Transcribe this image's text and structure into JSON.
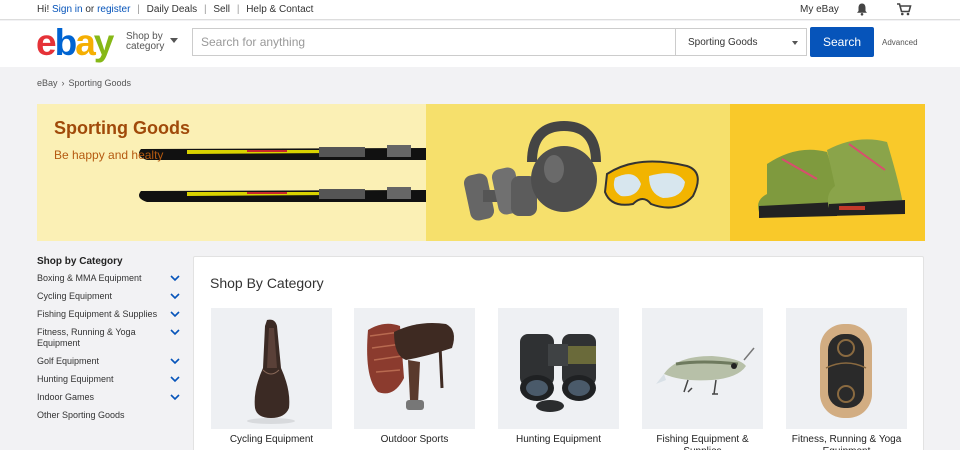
{
  "topbar": {
    "greeting": "Hi!",
    "sign_in": "Sign in",
    "or": "or",
    "register": "register",
    "links": [
      "Daily Deals",
      "Sell",
      "Help & Contact"
    ],
    "my_ebay": "My eBay"
  },
  "header": {
    "logo": {
      "e": "e",
      "b": "b",
      "a": "a",
      "y": "y"
    },
    "shop_by_line1": "Shop by",
    "shop_by_line2": "category",
    "search_placeholder": "Search for anything",
    "category_selected": "Sporting Goods",
    "search_button": "Search",
    "advanced": "Advanced"
  },
  "breadcrumb": {
    "home": "eBay",
    "chevron": "›",
    "current": "Sporting Goods"
  },
  "banner": {
    "title": "Sporting Goods",
    "subtitle": "Be happy and healty"
  },
  "sidebar": {
    "heading": "Shop by Category",
    "items": [
      {
        "label": "Boxing & MMA Equipment",
        "expandable": true
      },
      {
        "label": "Cycling Equipment",
        "expandable": true
      },
      {
        "label": "Fishing Equipment & Supplies",
        "expandable": true
      },
      {
        "label": "Fitness, Running & Yoga Equipment",
        "expandable": true
      },
      {
        "label": "Golf Equipment",
        "expandable": true
      },
      {
        "label": "Hunting Equipment",
        "expandable": true
      },
      {
        "label": "Indoor Games",
        "expandable": true
      },
      {
        "label": "Other Sporting Goods",
        "expandable": false
      }
    ]
  },
  "main": {
    "title": "Shop By Category",
    "cards": [
      {
        "label": "Cycling Equipment",
        "icon": "bike-saddle-icon"
      },
      {
        "label": "Outdoor Sports",
        "icon": "horse-saddle-icon"
      },
      {
        "label": "Hunting Equipment",
        "icon": "binoculars-icon"
      },
      {
        "label": "Fishing Equipment & Supplies",
        "icon": "fishing-lure-icon"
      },
      {
        "label": "Fitness, Running & Yoga Equipment",
        "icon": "yoga-wheel-icon"
      }
    ]
  },
  "colors": {
    "accent": "#0654ba",
    "banner_left": "#fbf0b5",
    "banner_mid": "#f6e06c",
    "banner_right": "#f9c92a"
  }
}
